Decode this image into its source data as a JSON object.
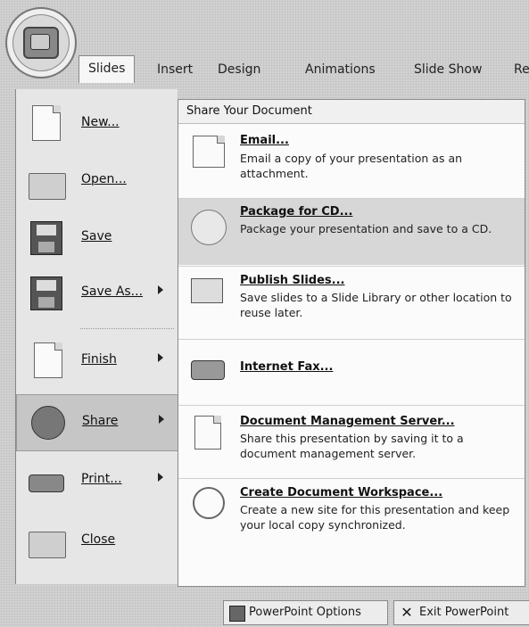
{
  "ribbon": {
    "tabs": [
      "Slides",
      "Insert",
      "Design",
      "Animations",
      "Slide Show",
      "Re"
    ]
  },
  "left_menu": {
    "items": [
      {
        "label": "New...",
        "icon": "new-document-icon",
        "has_submenu": false
      },
      {
        "label": "Open...",
        "icon": "open-folder-icon",
        "has_submenu": false
      },
      {
        "label": "Save",
        "icon": "save-floppy-icon",
        "has_submenu": false
      },
      {
        "label": "Save As...",
        "icon": "save-as-icon",
        "has_submenu": true
      },
      {
        "label": "Finish",
        "icon": "finish-pen-icon",
        "has_submenu": true
      },
      {
        "label": "Share",
        "icon": "share-people-icon",
        "has_submenu": true
      },
      {
        "label": "Print...",
        "icon": "printer-icon",
        "has_submenu": true
      },
      {
        "label": "Close",
        "icon": "close-folder-icon",
        "has_submenu": false
      }
    ],
    "active": "Share"
  },
  "share_panel": {
    "header": "Share Your Document",
    "options": [
      {
        "title": "Email...",
        "description": "Email a copy of your presentation as an attachment.",
        "icon": "email-icon"
      },
      {
        "title": "Package for CD...",
        "description": "Package your presentation and save to a CD.",
        "icon": "cd-icon"
      },
      {
        "title": "Publish Slides...",
        "description": "Save slides to a Slide Library or other location to reuse later.",
        "icon": "publish-slides-icon"
      },
      {
        "title": "Internet Fax...",
        "description": "",
        "icon": "fax-icon"
      },
      {
        "title": "Document Management Server...",
        "description": "Share this presentation by saving it to a document management server.",
        "icon": "document-server-icon"
      },
      {
        "title": "Create Document Workspace...",
        "description": "Create a new site for this presentation and keep your local copy synchronized.",
        "icon": "workspace-icon"
      }
    ]
  },
  "footer": {
    "options_label": "PowerPoint Options",
    "exit_label": "Exit PowerPoint"
  }
}
